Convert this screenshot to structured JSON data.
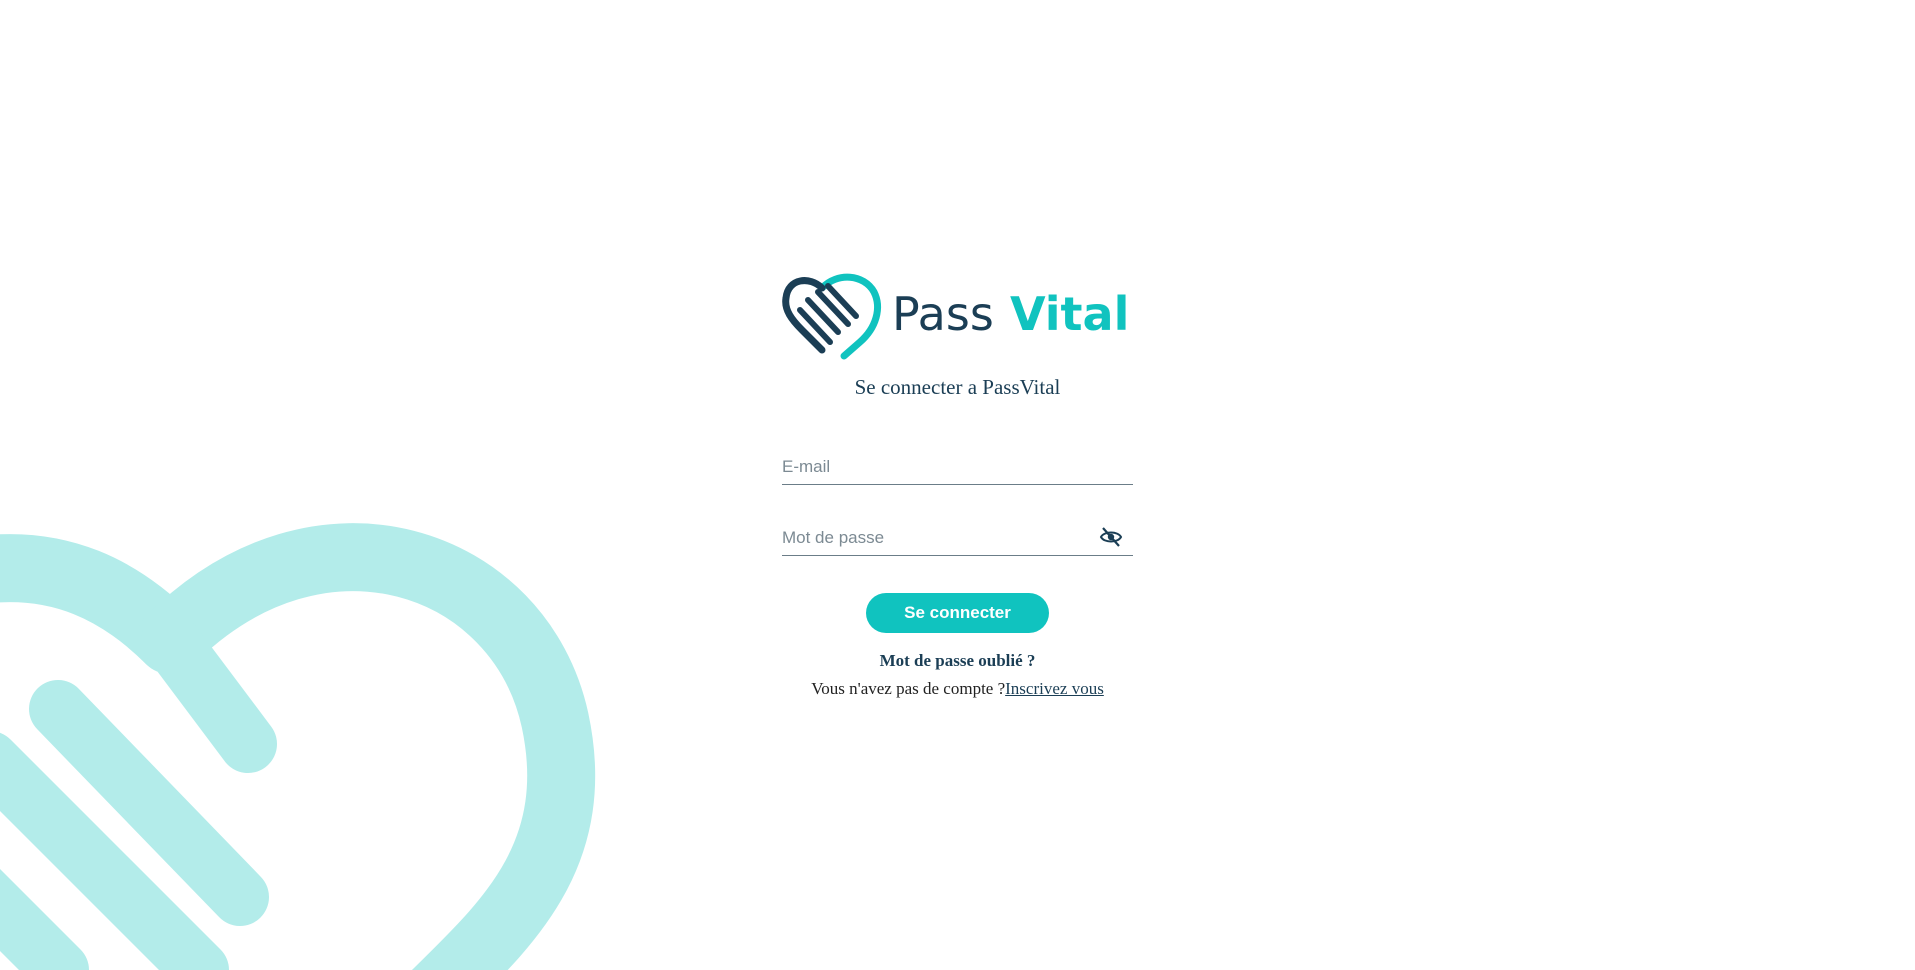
{
  "colors": {
    "brand_dark": "#1b3e55",
    "brand_teal": "#10c3bf",
    "background_graphic": "#b3ecea"
  },
  "logo": {
    "word_part1": "Pass",
    "word_part2": "Vital",
    "icon": "heart-hand-icon"
  },
  "heading": "Se connecter a PassVital",
  "form": {
    "email_placeholder": "E-mail",
    "email_value": "",
    "password_placeholder": "Mot de passe",
    "password_value": "",
    "password_toggle_icon": "eye-off-icon",
    "submit_label": "Se connecter"
  },
  "links": {
    "forgot_password": "Mot de passe oublié ?",
    "no_account_text": "Vous n'avez pas de compte ?",
    "signup": "Inscrivez vous"
  }
}
